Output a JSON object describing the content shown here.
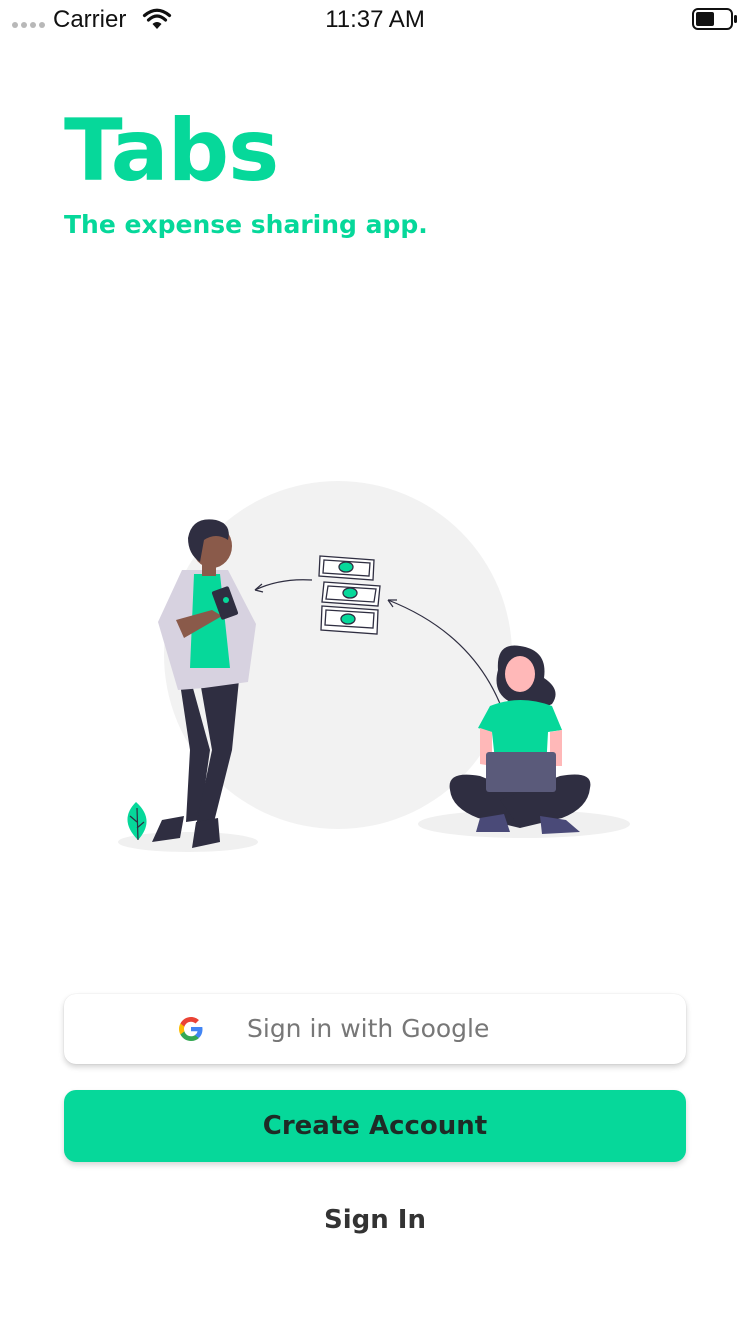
{
  "status_bar": {
    "carrier": "Carrier",
    "time": "11:37 AM",
    "icons": [
      "signal-dots-icon",
      "wifi-icon",
      "battery-icon"
    ]
  },
  "app": {
    "title": "Tabs",
    "tagline": "The expense sharing app."
  },
  "actions": {
    "google_label": "Sign in with Google",
    "create_account_label": "Create Account",
    "sign_in_label": "Sign In"
  },
  "colors": {
    "accent": "#06d89a",
    "background": "#ffffff",
    "illustration_circle": "#f2f2f2",
    "dark_figure": "#2f2e41",
    "laptop": "#5a5a7a",
    "skin_man": "#8a5a4a",
    "skin_woman": "#ffb8b8"
  }
}
